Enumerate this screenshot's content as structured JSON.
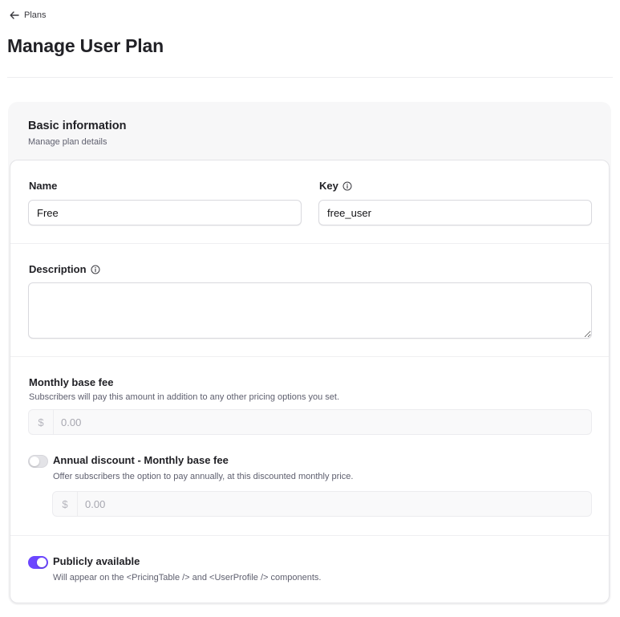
{
  "breadcrumb": {
    "back_label": "Plans"
  },
  "page": {
    "title": "Manage User Plan"
  },
  "card": {
    "title": "Basic information",
    "subtitle": "Manage plan details"
  },
  "fields": {
    "name": {
      "label": "Name",
      "value": "Free"
    },
    "key": {
      "label": "Key",
      "value": "free_user"
    },
    "description": {
      "label": "Description",
      "value": ""
    }
  },
  "monthly_fee": {
    "label": "Monthly base fee",
    "help": "Subscribers will pay this amount in addition to any other pricing options you set.",
    "currency": "$",
    "placeholder": "0.00"
  },
  "annual_discount": {
    "label": "Annual discount - Monthly base fee",
    "help": "Offer subscribers the option to pay annually, at this discounted monthly price.",
    "currency": "$",
    "placeholder": "0.00",
    "enabled": false
  },
  "public": {
    "label": "Publicly available",
    "help": "Will appear on the <PricingTable /> and <UserProfile /> components.",
    "enabled": true
  },
  "colors": {
    "accent": "#6c47ff",
    "toggle_off": "#e3e3e7"
  }
}
